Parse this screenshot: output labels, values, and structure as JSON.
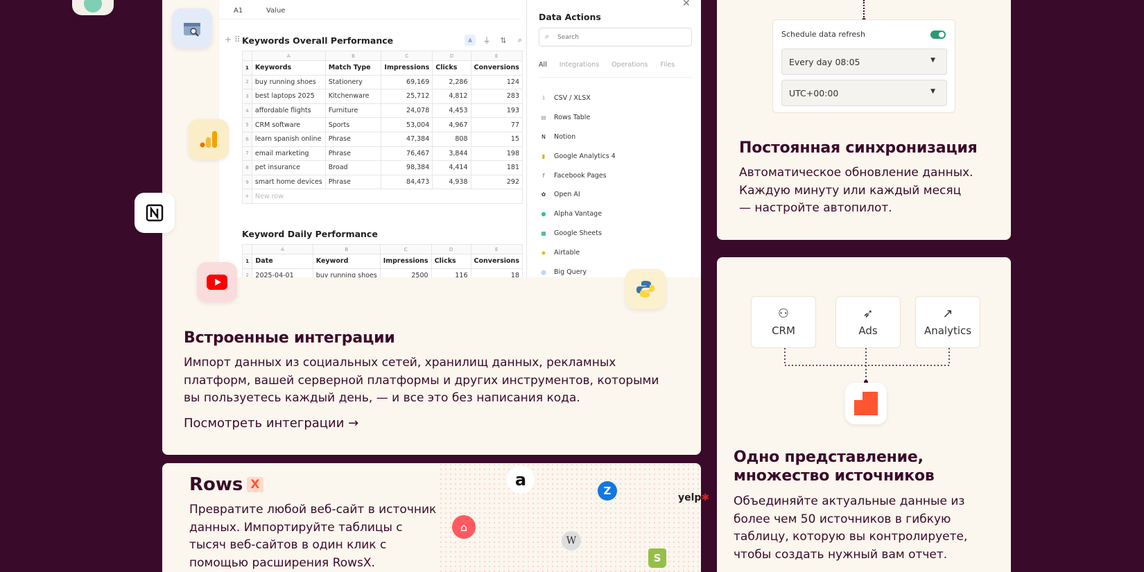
{
  "integrations_card": {
    "heading": "Встроенные интеграции",
    "description": "Импорт данных из социальных сетей, хранилищ данных, рекламных платформ, вашей серверной платформы и других инструментов, которыми вы пользуетесь каждый день, — и все это без написания кода.",
    "link": "Посмотреть интеграции →",
    "floating_icons": [
      "google-search-console-icon",
      "google-analytics-icon",
      "notion-icon",
      "youtube-icon",
      "python-icon"
    ]
  },
  "spreadsheet": {
    "cell_ref": "A1",
    "cell_value": "Value",
    "table1": {
      "title": "Keywords Overall Performance",
      "columns_letters": [
        "A",
        "B",
        "C",
        "D",
        "E"
      ],
      "headers": [
        "Keywords",
        "Match Type",
        "Impressions",
        "Clicks",
        "Conversions"
      ],
      "rows": [
        [
          "buy running shoes",
          "Stationery",
          "69,169",
          "2,286",
          "124"
        ],
        [
          "best laptops 2025",
          "Kitchenware",
          "25,712",
          "4,812",
          "283"
        ],
        [
          "affordable flights",
          "Furniture",
          "24,078",
          "4,453",
          "193"
        ],
        [
          "CRM software",
          "Sports",
          "53,004",
          "4,967",
          "77"
        ],
        [
          "learn spanish online",
          "Phrase",
          "47,384",
          "808",
          "15"
        ],
        [
          "email marketing",
          "Phrase",
          "76,467",
          "3,844",
          "198"
        ],
        [
          "pet insurance",
          "Broad",
          "98,384",
          "4,414",
          "181"
        ],
        [
          "smart home devices",
          "Phrase",
          "84,473",
          "4,938",
          "292"
        ]
      ],
      "new_row": "New row"
    },
    "table2": {
      "title": "Keyword Daily Performance",
      "columns_letters": [
        "A",
        "B",
        "C",
        "D",
        "E"
      ],
      "headers": [
        "Date",
        "Keyword",
        "Impressions",
        "Clicks",
        "Conversions"
      ],
      "rows": [
        [
          "2025-04-01",
          "buy running shoes",
          "2500",
          "116",
          "18"
        ]
      ]
    }
  },
  "data_actions": {
    "title": "Data Actions",
    "search_placeholder": "Search",
    "tabs": [
      "All",
      "Integrations",
      "Operations",
      "Files"
    ],
    "items": [
      {
        "label": "CSV / XLSX",
        "icon": "file-upload-icon",
        "color": "#9a9a9a"
      },
      {
        "label": "Rows Table",
        "icon": "table-icon",
        "color": "#9a9a9a"
      },
      {
        "label": "Notion",
        "icon": "notion-icon",
        "color": "#111111"
      },
      {
        "label": "Google Analytics 4",
        "icon": "google-analytics-icon",
        "color": "#f4a300"
      },
      {
        "label": "Facebook Pages",
        "icon": "facebook-icon",
        "color": "#1877f2"
      },
      {
        "label": "Open AI",
        "icon": "openai-icon",
        "color": "#333333"
      },
      {
        "label": "Alpha Vantage",
        "icon": "alpha-vantage-icon",
        "color": "#3bbf8f"
      },
      {
        "label": "Google Sheets",
        "icon": "google-sheets-icon",
        "color": "#1fa463"
      },
      {
        "label": "Airtable",
        "icon": "airtable-icon",
        "color": "#fcb400"
      },
      {
        "label": "Big Query",
        "icon": "bigquery-icon",
        "color": "#4285f4"
      }
    ]
  },
  "sync_card": {
    "schedule_label": "Schedule data refresh",
    "frequency_value": "Every day 08:05",
    "timezone_value": "UTC+00:00",
    "heading": "Постоянная синхронизация",
    "description": "Автоматическое обновление данных. Каждую минуту или каждый месяц — настройте автопилот."
  },
  "sources_card": {
    "sources": [
      {
        "label": "CRM",
        "icon": "user-icon"
      },
      {
        "label": "Ads",
        "icon": "rocket-icon"
      },
      {
        "label": "Analytics",
        "icon": "trend-up-icon"
      }
    ],
    "heading_line1": "Одно представление,",
    "heading_line2": "множество источников",
    "description": "Объединяйте актуальные данные из более чем 50 источников в гибкую таблицу, которую вы контролируете, чтобы создать нужный вам отчет."
  },
  "rowsx_card": {
    "brand": "Rows",
    "brand_badge": "X",
    "description": "Превратите любой веб-сайт в источник данных. Импортируйте таблицы с тысяч веб-сайтов в один клик с помощью расширения RowsX.",
    "logos": [
      "amazon-icon",
      "zillow-icon",
      "yelp-icon",
      "airbnb-icon",
      "wikipedia-icon",
      "shopify-icon"
    ],
    "yelp_text": "yelp"
  },
  "colors": {
    "background": "#3a0a2a",
    "card": "#fbf6ee",
    "accent_orange": "#ff5530",
    "toggle_green": "#2c9a77"
  }
}
